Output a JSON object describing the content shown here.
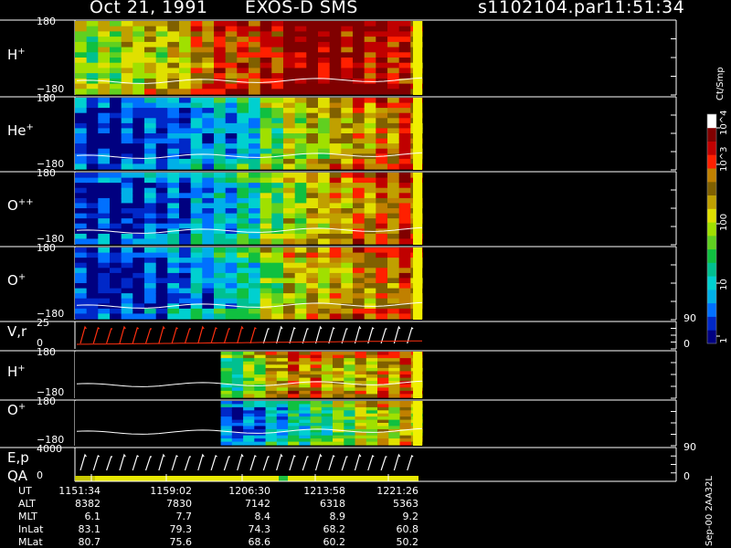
{
  "chart_data": {
    "type": "heatmap",
    "title": "Oct 21, 1991",
    "instrument": "EXOS-D SMS",
    "file_label": "s1102104.par",
    "time_label": "11:51:34",
    "colorbar": {
      "label": "Ct/Smp",
      "ticks": [
        "1",
        "10",
        "100",
        "10^3",
        "10^4"
      ],
      "colors": [
        "#000080",
        "#0028c8",
        "#0070ff",
        "#00b0e8",
        "#00d0d0",
        "#00c090",
        "#10c040",
        "#60d020",
        "#a0e000",
        "#e0e000",
        "#c0a000",
        "#806000",
        "#c08000",
        "#ff2000",
        "#c00000",
        "#800000",
        "#ffffff"
      ]
    },
    "panels": [
      {
        "id": "h1",
        "label": "H",
        "sup": "+",
        "y_top": "180",
        "y_bottom": "−180",
        "intensity": [
          0.45,
          0.47,
          0.48,
          0.5,
          0.52,
          0.54,
          0.56,
          0.58,
          0.62,
          0.66,
          0.7,
          0.74,
          0.76,
          0.78,
          0.8,
          0.82,
          0.85,
          0.88,
          0.92,
          0.95,
          0.97,
          0.98,
          0.98,
          0.97,
          0.95,
          0.93,
          0.9,
          0.88,
          0.82,
          0.78
        ]
      },
      {
        "id": "he1",
        "label": "He",
        "sup": "+",
        "y_top": "180",
        "y_bottom": "−180",
        "intensity": [
          0.02,
          0.02,
          0.03,
          0.04,
          0.05,
          0.06,
          0.08,
          0.1,
          0.12,
          0.14,
          0.15,
          0.16,
          0.2,
          0.22,
          0.25,
          0.28,
          0.38,
          0.45,
          0.5,
          0.52,
          0.55,
          0.58,
          0.62,
          0.65,
          0.66,
          0.68,
          0.7,
          0.72,
          0.74,
          0.75
        ]
      },
      {
        "id": "opp1",
        "label": "O",
        "sup": "++",
        "y_top": "180",
        "y_bottom": "−180",
        "intensity": [
          0.02,
          0.02,
          0.03,
          0.04,
          0.05,
          0.06,
          0.08,
          0.1,
          0.12,
          0.14,
          0.16,
          0.18,
          0.22,
          0.24,
          0.27,
          0.3,
          0.4,
          0.46,
          0.52,
          0.55,
          0.58,
          0.62,
          0.65,
          0.68,
          0.7,
          0.72,
          0.74,
          0.76,
          0.77,
          0.78
        ]
      },
      {
        "id": "op1",
        "label": "O",
        "sup": "+",
        "y_top": "180",
        "y_bottom": "−180",
        "intensity": [
          0.02,
          0.02,
          0.03,
          0.04,
          0.05,
          0.06,
          0.08,
          0.1,
          0.12,
          0.14,
          0.16,
          0.18,
          0.22,
          0.26,
          0.3,
          0.34,
          0.44,
          0.5,
          0.55,
          0.58,
          0.6,
          0.62,
          0.64,
          0.66,
          0.68,
          0.7,
          0.72,
          0.74,
          0.76,
          0.78
        ]
      },
      {
        "id": "vr",
        "label": "V,r",
        "y_top": "25",
        "y_bottom": "0",
        "right_top": "90",
        "right_bottom": "0",
        "kind": "trace"
      },
      {
        "id": "h2",
        "label": "H",
        "sup": "+",
        "y_top": "180",
        "y_bottom": "−180",
        "start_fraction": 0.42,
        "intensity": [
          0.3,
          0.35,
          0.45,
          0.55,
          0.62,
          0.7,
          0.75,
          0.72,
          0.7,
          0.66,
          0.62,
          0.6,
          0.6,
          0.64,
          0.68,
          0.7,
          0.72,
          0.74
        ]
      },
      {
        "id": "o2",
        "label": "O",
        "sup": "+",
        "y_top": "180",
        "y_bottom": "−180",
        "start_fraction": 0.42,
        "intensity": [
          0.08,
          0.1,
          0.12,
          0.15,
          0.18,
          0.22,
          0.26,
          0.3,
          0.34,
          0.38,
          0.42,
          0.46,
          0.5,
          0.54,
          0.56,
          0.58,
          0.6,
          0.62
        ]
      },
      {
        "id": "ep",
        "label": "E,p",
        "label2": "QA",
        "y_top": "4000",
        "y_bottom": "0",
        "right_top": "90",
        "right_bottom": "0",
        "kind": "trace"
      }
    ],
    "time_axis": {
      "rows": [
        {
          "name": "UT",
          "values": [
            "1151:34",
            "1159:02",
            "1206:30",
            "1213:58",
            "1221:26"
          ]
        },
        {
          "name": "ALT",
          "values": [
            "8382",
            "7830",
            "7142",
            "6318",
            "5363"
          ]
        },
        {
          "name": "MLT",
          "values": [
            "6.1",
            "7.7",
            "8.4",
            "8.9",
            "9.2"
          ]
        },
        {
          "name": "InLat",
          "values": [
            "83.1",
            "79.3",
            "74.3",
            "68.2",
            "60.8"
          ]
        },
        {
          "name": "MLat",
          "values": [
            "80.7",
            "75.6",
            "68.6",
            "60.2",
            "50.2"
          ]
        }
      ]
    },
    "footnote": "Sep-00 2AA32L"
  }
}
